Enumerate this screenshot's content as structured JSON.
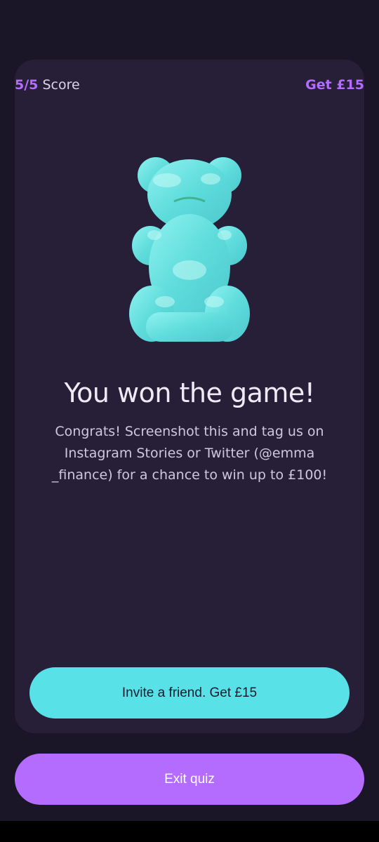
{
  "header": {
    "score_value": "5/5",
    "score_label": "Score",
    "reward_label": "Get £15"
  },
  "result": {
    "image_icon": "gummy-bear",
    "title": "You won the game!",
    "message": "Congrats! Screenshot this and tag us on Instagram Stories or Twitter (@emma _finance) for a chance to win up to £100!"
  },
  "actions": {
    "invite_label": "Invite a friend. Get £15",
    "exit_label": "Exit quiz"
  },
  "colors": {
    "background": "#1b1528",
    "card": "#261f37",
    "accent_purple": "#b46cff",
    "accent_cyan": "#59e1e8"
  }
}
